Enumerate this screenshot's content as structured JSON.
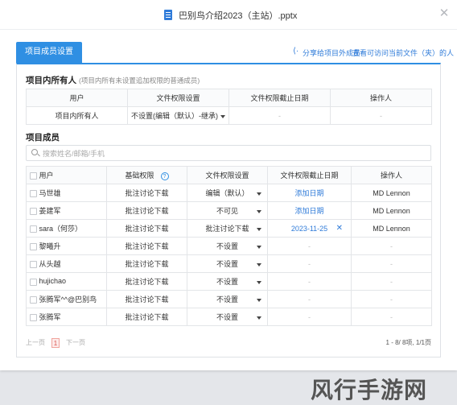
{
  "window": {
    "title": "巴别鸟介绍2023（主站）.pptx",
    "close_icon": "close-icon"
  },
  "tabs": {
    "active": "项目成员设置",
    "share_link": "分享给项目外成员",
    "view_link": "查看可访问当前文件（夹）的人"
  },
  "owners_section": {
    "title": "项目内所有人",
    "note": "(项目内所有未设置追加权限的普通成员)",
    "headers": [
      "用户",
      "文件权限设置",
      "文件权限截止日期",
      "操作人"
    ],
    "row": {
      "user": "项目内所有人",
      "permission": "不设置(编辑（默认）-继承)",
      "deadline": "-",
      "operator": "-"
    }
  },
  "members_section": {
    "title": "项目成员",
    "search_placeholder": "搜索姓名/邮箱/手机",
    "headers": [
      "用户",
      "基础权限",
      "文件权限设置",
      "文件权限截止日期",
      "操作人"
    ],
    "help_icon": "?",
    "rows": [
      {
        "user": "马世雄",
        "base": "批注讨论下载",
        "permission": "编辑（默认）",
        "deadline": "添加日期",
        "operator": "MD Lennon"
      },
      {
        "user": "姜建军",
        "base": "批注讨论下载",
        "permission": "不可见",
        "deadline": "添加日期",
        "operator": "MD Lennon"
      },
      {
        "user": "sara（何莎）",
        "base": "批注讨论下载",
        "permission": "批注讨论下载",
        "deadline": "2023-11-25",
        "operator": "MD Lennon"
      },
      {
        "user": "黎曦升",
        "base": "批注讨论下载",
        "permission": "不设置",
        "deadline": "-",
        "operator": "-"
      },
      {
        "user": "从头越",
        "base": "批注讨论下载",
        "permission": "不设置",
        "deadline": "-",
        "operator": "-"
      },
      {
        "user": "hujichao",
        "base": "批注讨论下载",
        "permission": "不设置",
        "deadline": "-",
        "operator": "-"
      },
      {
        "user": "张腾军^^@巴别鸟",
        "base": "批注讨论下载",
        "permission": "不设置",
        "deadline": "-",
        "operator": "-"
      },
      {
        "user": "张腾军",
        "base": "批注讨论下载",
        "permission": "不设置",
        "deadline": "-",
        "operator": "-"
      }
    ]
  },
  "pagination": {
    "prev": "上一页",
    "current": "1",
    "next": "下一页",
    "info": "1 - 8/ 8项, 1/1页"
  },
  "watermark": {
    "text": "风行手游网"
  },
  "colors": {
    "accent": "#2f8fe3",
    "link": "#2f7bd9"
  }
}
